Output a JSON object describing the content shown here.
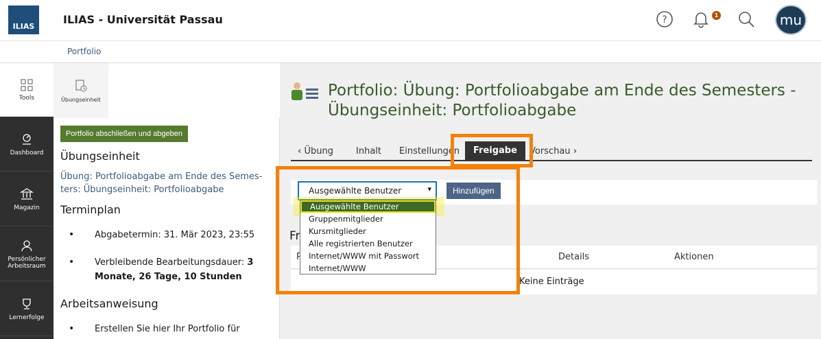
{
  "header": {
    "logo_text": "ILIAS",
    "title": "ILIAS - Universität Passau",
    "help_icon": "help-icon",
    "notification_count": "1",
    "avatar_initials": "mu"
  },
  "breadcrumb": {
    "item": "Portfolio"
  },
  "mainbar": {
    "items": [
      {
        "label": "Tools",
        "icon": "grid-icon"
      },
      {
        "label": "Dashboard",
        "icon": "dashboard-icon"
      },
      {
        "label": "Magazin",
        "icon": "repository-icon"
      },
      {
        "label": "Persönlicher Arbeitsraum",
        "icon": "person-icon"
      },
      {
        "label": "Lernerfolge",
        "icon": "trophy-icon"
      }
    ]
  },
  "slate": {
    "tab_label": "Übungseinheit",
    "finish_button": "Portfolio abschließen und abgeben",
    "heading_unit": "Übungseinheit",
    "description": "Übung: Portfolioabgabe am Ende des Semes-ters: Übungseinheit: Portfolioabgabe",
    "heading_schedule": "Terminplan",
    "deadline": "Abgabetermin: 31. Mär 2023, 23:55",
    "remaining_prefix": "Verbleibende Bearbeitungsdauer: ",
    "remaining_value": "3 Monate, 26 Tage, 10 Stunden",
    "heading_instructions": "Arbeitsanweisung",
    "instruction_text": "Erstellen Sie hier Ihr Portfolio für"
  },
  "content": {
    "title": "Portfolio: Übung: Portfolioabgabe am Ende des Semesters - Übungseinheit: Portfolioabgabe",
    "tabs": {
      "back": "Übung",
      "content": "Inhalt",
      "settings": "Einstellungen",
      "share": "Freigabe",
      "preview": "Vorschau"
    },
    "select_value": "Ausgewählte Benutzer",
    "add_button": "Hinzufügen",
    "section_heading": "Fr",
    "table_col_first": "P",
    "table_col_details": "Details",
    "table_col_actions": "Aktionen",
    "empty_text": "Keine Einträge",
    "dropdown_options": [
      "Ausgewählte Benutzer",
      "Gruppenmitglieder",
      "Kursmitglieder",
      "Alle registrierten Benutzer",
      "Internet/WWW mit Passwort",
      "Internet/WWW"
    ]
  },
  "colors": {
    "highlight_orange": "#f4810b",
    "highlight_yellow": "#f5f03c",
    "title_green": "#3a5a2c",
    "button_green": "#557b2e"
  }
}
